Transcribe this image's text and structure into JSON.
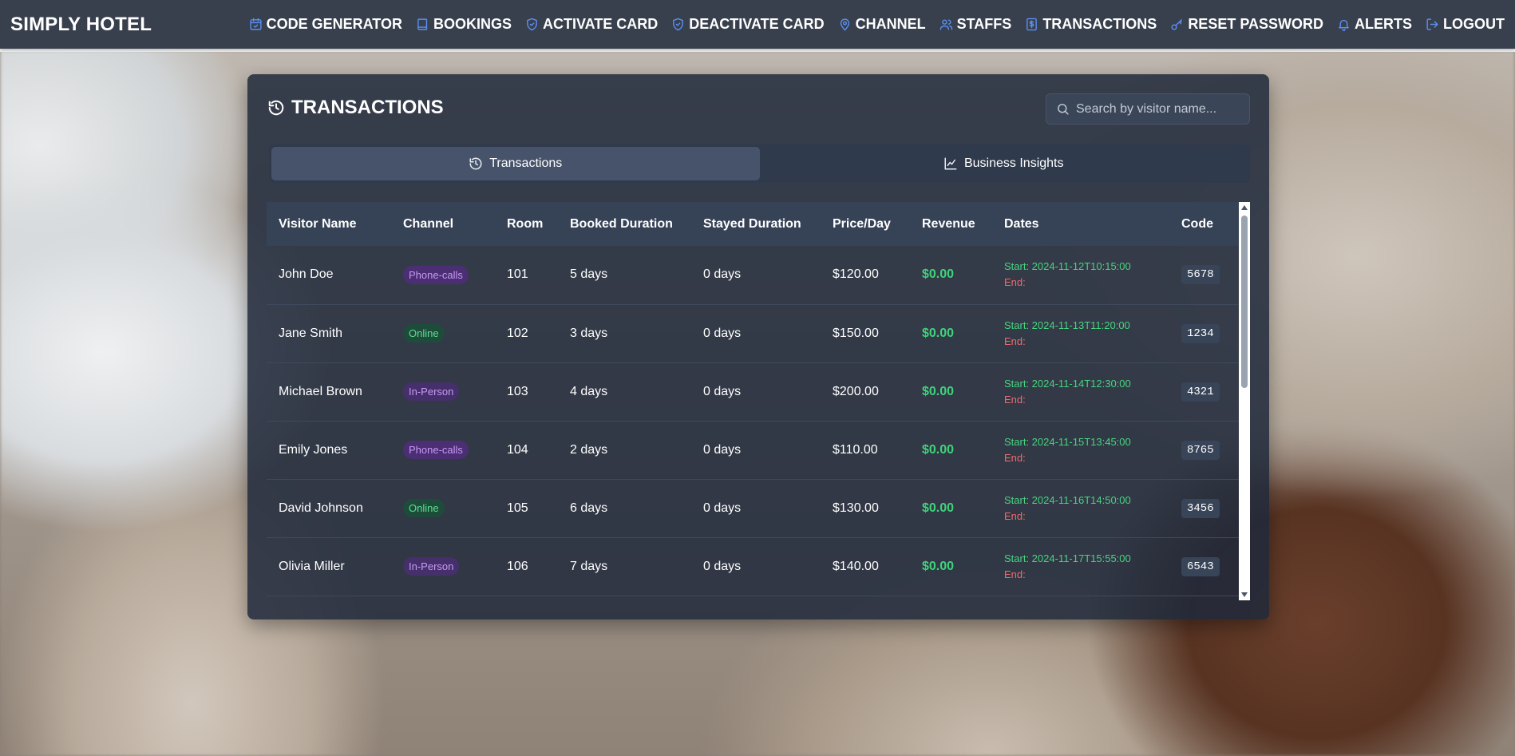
{
  "app": {
    "brand": "SIMPLY HOTEL"
  },
  "nav": [
    {
      "label": "CODE GENERATOR",
      "icon": "calendar-icon"
    },
    {
      "label": "BOOKINGS",
      "icon": "book-icon"
    },
    {
      "label": "ACTIVATE CARD",
      "icon": "shield-check-icon"
    },
    {
      "label": "DEACTIVATE CARD",
      "icon": "shield-icon"
    },
    {
      "label": "CHANNEL",
      "icon": "map-pin-icon"
    },
    {
      "label": "STAFFS",
      "icon": "users-icon"
    },
    {
      "label": "TRANSACTIONS",
      "icon": "receipt-icon"
    },
    {
      "label": "RESET PASSWORD",
      "icon": "key-icon"
    },
    {
      "label": "ALERTS",
      "icon": "bell-icon"
    },
    {
      "label": "LOGOUT",
      "icon": "logout-icon"
    }
  ],
  "panel": {
    "title": "TRANSACTIONS",
    "search_placeholder": "Search by visitor name...",
    "tabs": [
      {
        "label": "Transactions",
        "active": true
      },
      {
        "label": "Business Insights",
        "active": false
      }
    ]
  },
  "table": {
    "columns": [
      "Visitor Name",
      "Channel",
      "Room",
      "Booked Duration",
      "Stayed Duration",
      "Price/Day",
      "Revenue",
      "Dates",
      "Code"
    ],
    "rows": [
      {
        "name": "John Doe",
        "channel": "Phone-calls",
        "room": "101",
        "booked": "5 days",
        "stayed": "0 days",
        "price": "$120.00",
        "revenue": "$0.00",
        "start": "Start: 2024-11-12T10:15:00",
        "end": "End:",
        "code": "5678"
      },
      {
        "name": "Jane Smith",
        "channel": "Online",
        "room": "102",
        "booked": "3 days",
        "stayed": "0 days",
        "price": "$150.00",
        "revenue": "$0.00",
        "start": "Start: 2024-11-13T11:20:00",
        "end": "End:",
        "code": "1234"
      },
      {
        "name": "Michael Brown",
        "channel": "In-Person",
        "room": "103",
        "booked": "4 days",
        "stayed": "0 days",
        "price": "$200.00",
        "revenue": "$0.00",
        "start": "Start: 2024-11-14T12:30:00",
        "end": "End:",
        "code": "4321"
      },
      {
        "name": "Emily Jones",
        "channel": "Phone-calls",
        "room": "104",
        "booked": "2 days",
        "stayed": "0 days",
        "price": "$110.00",
        "revenue": "$0.00",
        "start": "Start: 2024-11-15T13:45:00",
        "end": "End:",
        "code": "8765"
      },
      {
        "name": "David Johnson",
        "channel": "Online",
        "room": "105",
        "booked": "6 days",
        "stayed": "0 days",
        "price": "$130.00",
        "revenue": "$0.00",
        "start": "Start: 2024-11-16T14:50:00",
        "end": "End:",
        "code": "3456"
      },
      {
        "name": "Olivia Miller",
        "channel": "In-Person",
        "room": "106",
        "booked": "7 days",
        "stayed": "0 days",
        "price": "$140.00",
        "revenue": "$0.00",
        "start": "Start: 2024-11-17T15:55:00",
        "end": "End:",
        "code": "6543"
      }
    ]
  },
  "colors": {
    "nav_bg": "#383f4d",
    "accent_icon": "#5b8ff0",
    "revenue": "#3fd37b",
    "start": "#46d47f",
    "end": "#f06a6a"
  }
}
